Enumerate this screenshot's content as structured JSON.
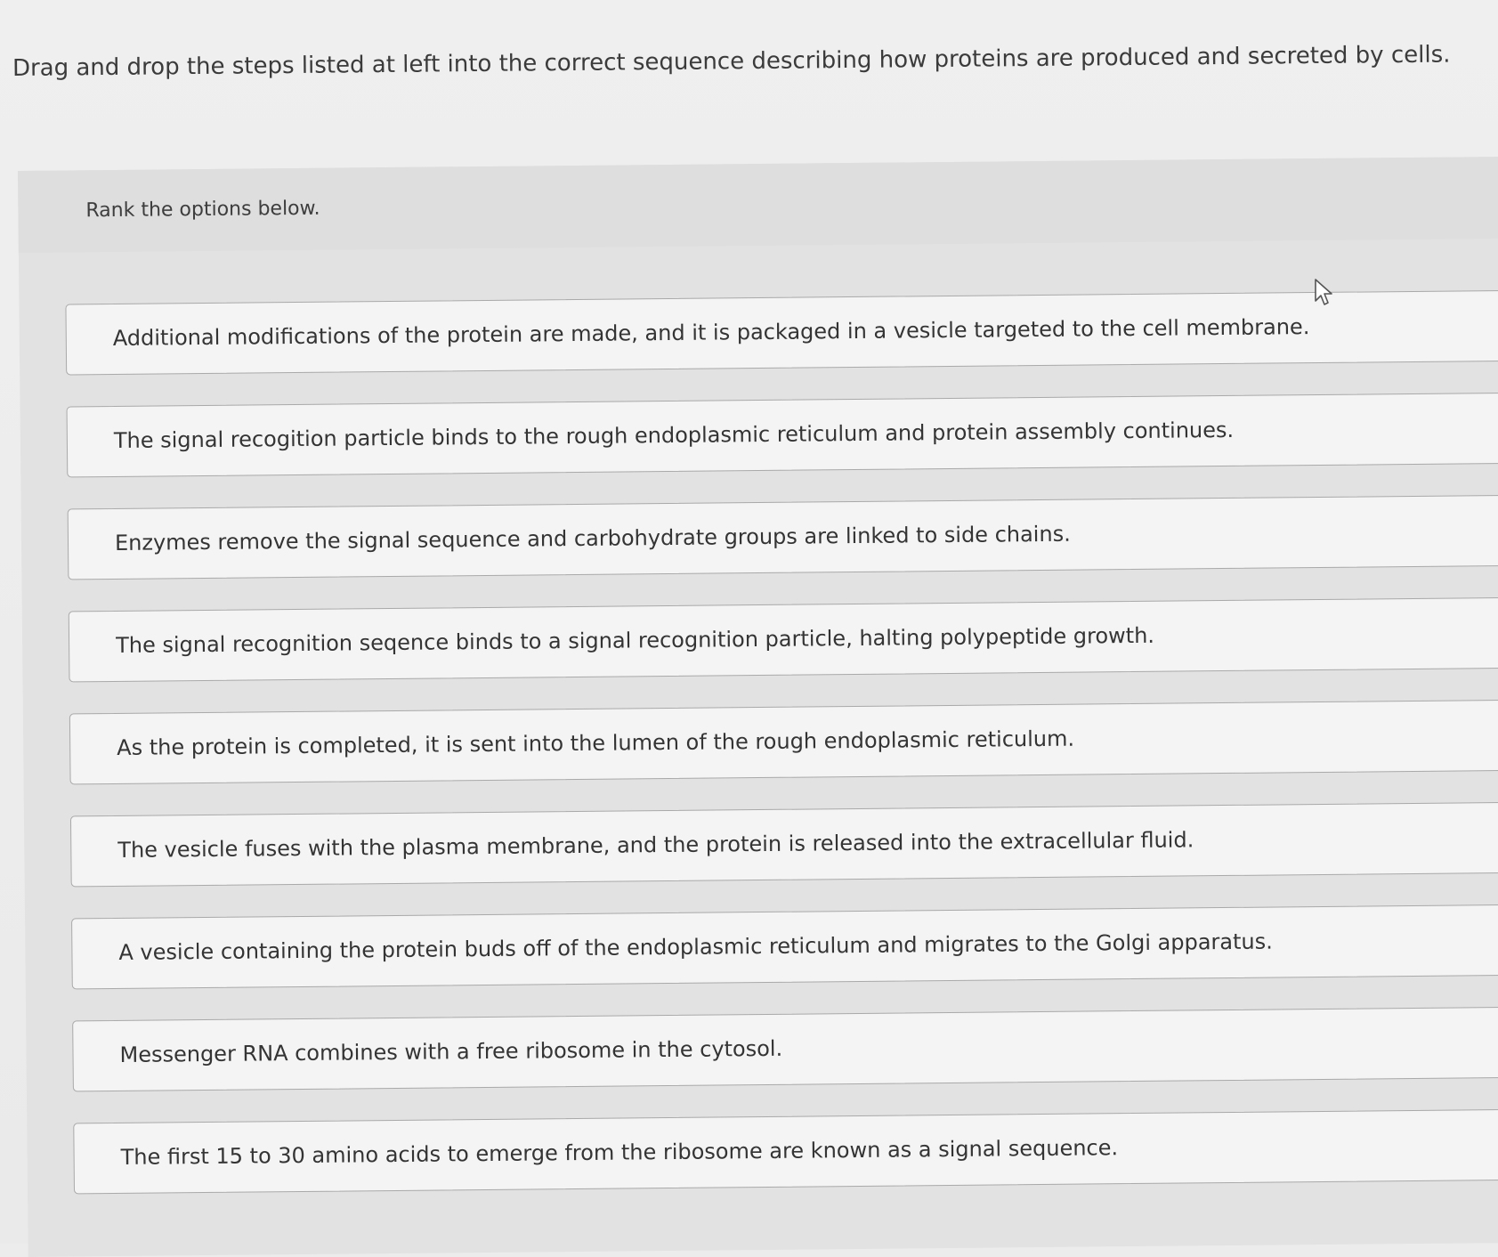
{
  "instruction": "Drag and drop the steps listed at left into the correct sequence describing how proteins are produced and secreted by cells.",
  "rank_label": "Rank the options below.",
  "options": [
    {
      "label": "Additional modifications of the protein are made, and it is packaged in a vesicle targeted to the cell membrane."
    },
    {
      "label": "The signal recogition particle binds to the rough endoplasmic reticulum and protein assembly continues."
    },
    {
      "label": "Enzymes remove the signal sequence and carbohydrate groups are linked to side chains."
    },
    {
      "label": "The signal recognition seqence binds to a signal recognition particle, halting polypeptide growth."
    },
    {
      "label": "As the protein is completed, it is sent into the lumen of the rough endoplasmic reticulum."
    },
    {
      "label": "The vesicle fuses with the plasma membrane, and the protein is released into the extracellular fluid."
    },
    {
      "label": "A vesicle containing the protein buds off of the endoplasmic reticulum and migrates to the Golgi apparatus."
    },
    {
      "label": "Messenger RNA combines with a free ribosome in the cytosol."
    },
    {
      "label": "The first 15 to 30 amino acids to emerge from the ribosome are known as a signal sequence."
    }
  ],
  "icons": {
    "cursor": "mouse-pointer-arrow"
  }
}
